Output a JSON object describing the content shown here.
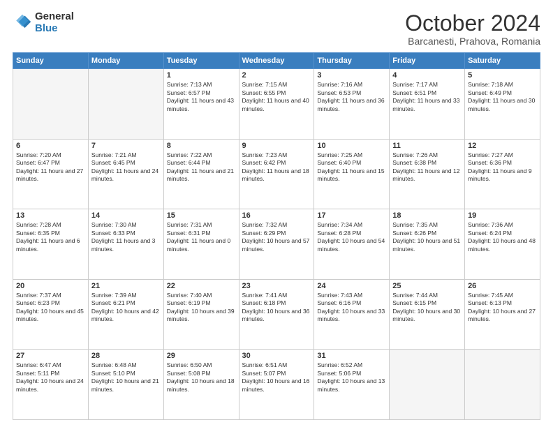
{
  "logo": {
    "general": "General",
    "blue": "Blue"
  },
  "header": {
    "month_year": "October 2024",
    "location": "Barcanesti, Prahova, Romania"
  },
  "weekdays": [
    "Sunday",
    "Monday",
    "Tuesday",
    "Wednesday",
    "Thursday",
    "Friday",
    "Saturday"
  ],
  "weeks": [
    [
      {
        "day": "",
        "empty": true
      },
      {
        "day": "",
        "empty": true
      },
      {
        "day": "1",
        "sunrise": "7:13 AM",
        "sunset": "6:57 PM",
        "daylight": "11 hours and 43 minutes."
      },
      {
        "day": "2",
        "sunrise": "7:15 AM",
        "sunset": "6:55 PM",
        "daylight": "11 hours and 40 minutes."
      },
      {
        "day": "3",
        "sunrise": "7:16 AM",
        "sunset": "6:53 PM",
        "daylight": "11 hours and 36 minutes."
      },
      {
        "day": "4",
        "sunrise": "7:17 AM",
        "sunset": "6:51 PM",
        "daylight": "11 hours and 33 minutes."
      },
      {
        "day": "5",
        "sunrise": "7:18 AM",
        "sunset": "6:49 PM",
        "daylight": "11 hours and 30 minutes."
      }
    ],
    [
      {
        "day": "6",
        "sunrise": "7:20 AM",
        "sunset": "6:47 PM",
        "daylight": "11 hours and 27 minutes."
      },
      {
        "day": "7",
        "sunrise": "7:21 AM",
        "sunset": "6:45 PM",
        "daylight": "11 hours and 24 minutes."
      },
      {
        "day": "8",
        "sunrise": "7:22 AM",
        "sunset": "6:44 PM",
        "daylight": "11 hours and 21 minutes."
      },
      {
        "day": "9",
        "sunrise": "7:23 AM",
        "sunset": "6:42 PM",
        "daylight": "11 hours and 18 minutes."
      },
      {
        "day": "10",
        "sunrise": "7:25 AM",
        "sunset": "6:40 PM",
        "daylight": "11 hours and 15 minutes."
      },
      {
        "day": "11",
        "sunrise": "7:26 AM",
        "sunset": "6:38 PM",
        "daylight": "11 hours and 12 minutes."
      },
      {
        "day": "12",
        "sunrise": "7:27 AM",
        "sunset": "6:36 PM",
        "daylight": "11 hours and 9 minutes."
      }
    ],
    [
      {
        "day": "13",
        "sunrise": "7:28 AM",
        "sunset": "6:35 PM",
        "daylight": "11 hours and 6 minutes."
      },
      {
        "day": "14",
        "sunrise": "7:30 AM",
        "sunset": "6:33 PM",
        "daylight": "11 hours and 3 minutes."
      },
      {
        "day": "15",
        "sunrise": "7:31 AM",
        "sunset": "6:31 PM",
        "daylight": "11 hours and 0 minutes."
      },
      {
        "day": "16",
        "sunrise": "7:32 AM",
        "sunset": "6:29 PM",
        "daylight": "10 hours and 57 minutes."
      },
      {
        "day": "17",
        "sunrise": "7:34 AM",
        "sunset": "6:28 PM",
        "daylight": "10 hours and 54 minutes."
      },
      {
        "day": "18",
        "sunrise": "7:35 AM",
        "sunset": "6:26 PM",
        "daylight": "10 hours and 51 minutes."
      },
      {
        "day": "19",
        "sunrise": "7:36 AM",
        "sunset": "6:24 PM",
        "daylight": "10 hours and 48 minutes."
      }
    ],
    [
      {
        "day": "20",
        "sunrise": "7:37 AM",
        "sunset": "6:23 PM",
        "daylight": "10 hours and 45 minutes."
      },
      {
        "day": "21",
        "sunrise": "7:39 AM",
        "sunset": "6:21 PM",
        "daylight": "10 hours and 42 minutes."
      },
      {
        "day": "22",
        "sunrise": "7:40 AM",
        "sunset": "6:19 PM",
        "daylight": "10 hours and 39 minutes."
      },
      {
        "day": "23",
        "sunrise": "7:41 AM",
        "sunset": "6:18 PM",
        "daylight": "10 hours and 36 minutes."
      },
      {
        "day": "24",
        "sunrise": "7:43 AM",
        "sunset": "6:16 PM",
        "daylight": "10 hours and 33 minutes."
      },
      {
        "day": "25",
        "sunrise": "7:44 AM",
        "sunset": "6:15 PM",
        "daylight": "10 hours and 30 minutes."
      },
      {
        "day": "26",
        "sunrise": "7:45 AM",
        "sunset": "6:13 PM",
        "daylight": "10 hours and 27 minutes."
      }
    ],
    [
      {
        "day": "27",
        "sunrise": "6:47 AM",
        "sunset": "5:11 PM",
        "daylight": "10 hours and 24 minutes."
      },
      {
        "day": "28",
        "sunrise": "6:48 AM",
        "sunset": "5:10 PM",
        "daylight": "10 hours and 21 minutes."
      },
      {
        "day": "29",
        "sunrise": "6:50 AM",
        "sunset": "5:08 PM",
        "daylight": "10 hours and 18 minutes."
      },
      {
        "day": "30",
        "sunrise": "6:51 AM",
        "sunset": "5:07 PM",
        "daylight": "10 hours and 16 minutes."
      },
      {
        "day": "31",
        "sunrise": "6:52 AM",
        "sunset": "5:06 PM",
        "daylight": "10 hours and 13 minutes."
      },
      {
        "day": "",
        "empty": true
      },
      {
        "day": "",
        "empty": true
      }
    ]
  ]
}
